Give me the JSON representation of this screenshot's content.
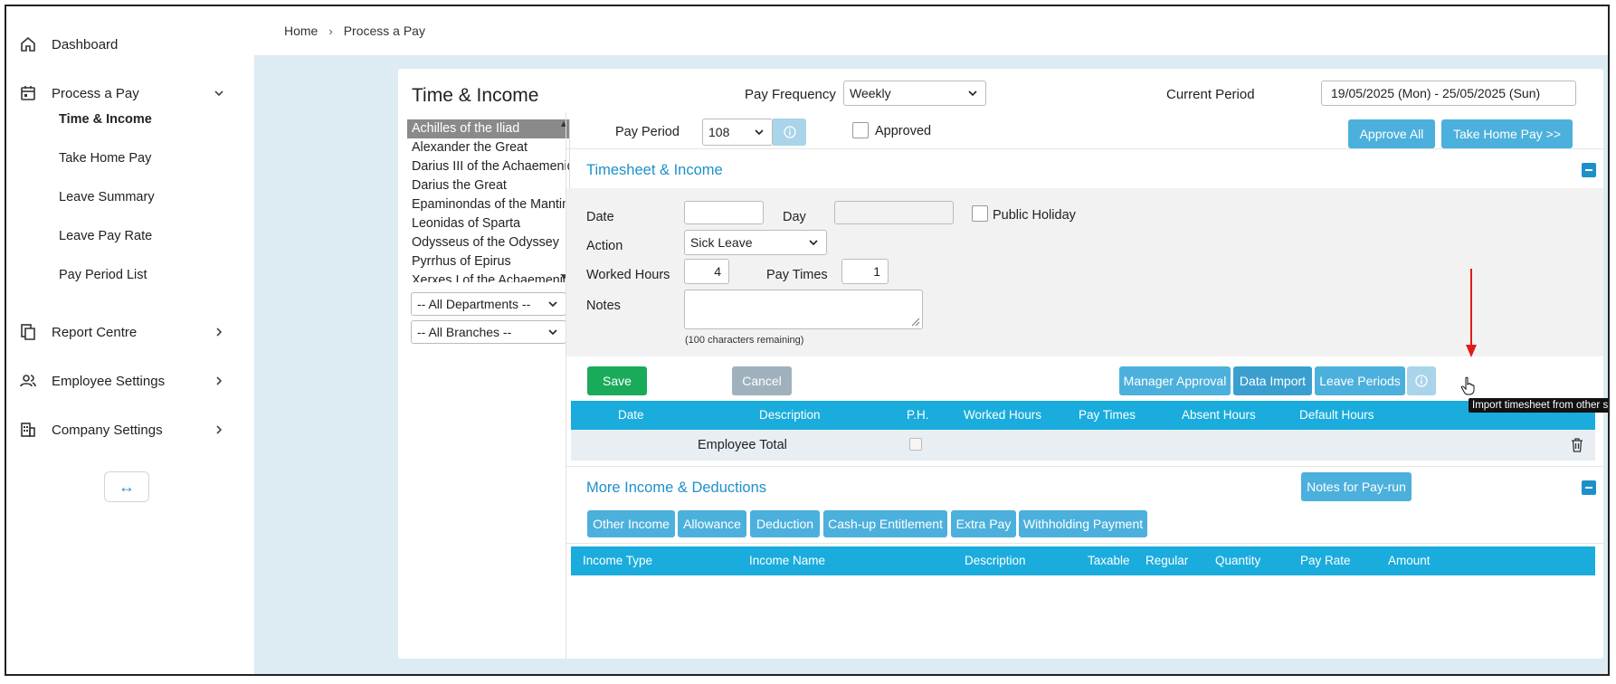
{
  "sidebar": {
    "items": [
      {
        "label": "Dashboard"
      },
      {
        "label": "Process a Pay"
      },
      {
        "label": "Report Centre"
      },
      {
        "label": "Employee Settings"
      },
      {
        "label": "Company Settings"
      }
    ],
    "sub_items": [
      {
        "label": "Time & Income",
        "active": true
      },
      {
        "label": "Take Home Pay"
      },
      {
        "label": "Leave Summary"
      },
      {
        "label": "Leave Pay Rate"
      },
      {
        "label": "Pay Period List"
      }
    ],
    "collapse_symbol": "↔"
  },
  "breadcrumb": {
    "home": "Home",
    "sep": "›",
    "current": "Process a Pay"
  },
  "panel": {
    "title": "Time & Income",
    "pay_frequency_label": "Pay Frequency",
    "pay_frequency_value": "Weekly",
    "current_period_label": "Current Period",
    "current_period_value": "19/05/2025 (Mon) - 25/05/2025 (Sun)"
  },
  "employees": [
    "Achilles of the Iliad",
    "Alexander the Great",
    "Darius III of the Achaemenid",
    "Darius the Great",
    "Epaminondas of the Mantinea",
    "Leonidas of Sparta",
    "Odysseus of the Odyssey",
    "Pyrrhus of Epirus",
    "Xerxes I of the Achaemenid"
  ],
  "filters": {
    "departments": "-- All Departments --",
    "branches": "-- All Branches --"
  },
  "pay_period": {
    "label": "Pay Period",
    "value": "108",
    "approved_label": "Approved",
    "approve_all": "Approve All",
    "take_home_pay": "Take Home Pay >>"
  },
  "timesheet": {
    "title": "Timesheet & Income",
    "date_label": "Date",
    "day_label": "Day",
    "public_holiday_label": "Public Holiday",
    "action_label": "Action",
    "action_value": "Sick Leave",
    "worked_hours_label": "Worked Hours",
    "worked_hours_value": "4",
    "pay_times_label": "Pay Times",
    "pay_times_value": "1",
    "notes_label": "Notes",
    "notes_remaining": "(100 characters remaining)"
  },
  "actions": {
    "save": "Save",
    "cancel": "Cancel",
    "manager_approval": "Manager Approval",
    "data_import": "Data Import",
    "leave_periods": "Leave Periods",
    "tooltip": "Import timesheet from other systems."
  },
  "timesheet_table": {
    "columns": [
      "Date",
      "Description",
      "P.H.",
      "Worked Hours",
      "Pay Times",
      "Absent Hours",
      "Default Hours"
    ],
    "total_label": "Employee Total"
  },
  "more_income": {
    "title": "More Income & Deductions",
    "notes_for_payrun": "Notes for Pay-run",
    "tabs": [
      "Other Income",
      "Allowance",
      "Deduction",
      "Cash-up Entitlement",
      "Extra Pay",
      "Withholding Payment"
    ],
    "columns": [
      "Income Type",
      "Income Name",
      "Description",
      "Taxable",
      "Regular",
      "Quantity",
      "Pay Rate",
      "Amount"
    ]
  },
  "colors": {
    "accent": "#1e90c9",
    "button": "#4cb0dc",
    "save": "#1aab5a",
    "table_header": "#1aacdc",
    "annotation_arrow": "#e01b1b"
  }
}
